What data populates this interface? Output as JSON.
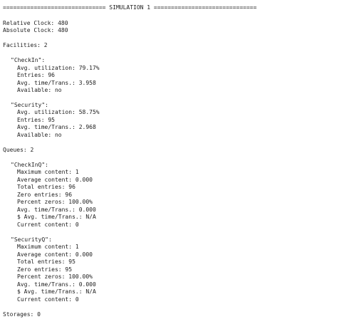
{
  "header": {
    "title": "============================== SIMULATION 1 =============================="
  },
  "clock": {
    "relative": "Relative Clock: 480",
    "absolute": "Absolute Clock: 480"
  },
  "facilities": {
    "heading": "Facilities: 2",
    "items": [
      {
        "name": "\"CheckIn\":",
        "avg_utilization": "Avg. utilization: 79.17%",
        "entries": "Entries: 96",
        "avg_time": "Avg. time/Trans.: 3.958",
        "available": "Available: no"
      },
      {
        "name": "\"Security\":",
        "avg_utilization": "Avg. utilization: 58.75%",
        "entries": "Entries: 95",
        "avg_time": "Avg. time/Trans.: 2.968",
        "available": "Available: no"
      }
    ]
  },
  "queues": {
    "heading": "Queues: 2",
    "items": [
      {
        "name": "\"CheckInQ\":",
        "maximum_content": "Maximum content: 1",
        "average_content": "Average content: 0.000",
        "total_entries": "Total entries: 96",
        "zero_entries": "Zero entries: 96",
        "percent_zeros": "Percent zeros: 100.00%",
        "avg_time": "Avg. time/Trans.: 0.000",
        "dollar_avg_time": "$ Avg. time/Trans.: N/A",
        "current_content": "Current content: 0"
      },
      {
        "name": "\"SecurityQ\":",
        "maximum_content": "Maximum content: 1",
        "average_content": "Average content: 0.000",
        "total_entries": "Total entries: 95",
        "zero_entries": "Zero entries: 95",
        "percent_zeros": "Percent zeros: 100.00%",
        "avg_time": "Avg. time/Trans.: 0.000",
        "dollar_avg_time": "$ Avg. time/Trans.: N/A",
        "current_content": "Current content: 0"
      }
    ]
  },
  "storages": {
    "heading": "Storages: 0"
  }
}
